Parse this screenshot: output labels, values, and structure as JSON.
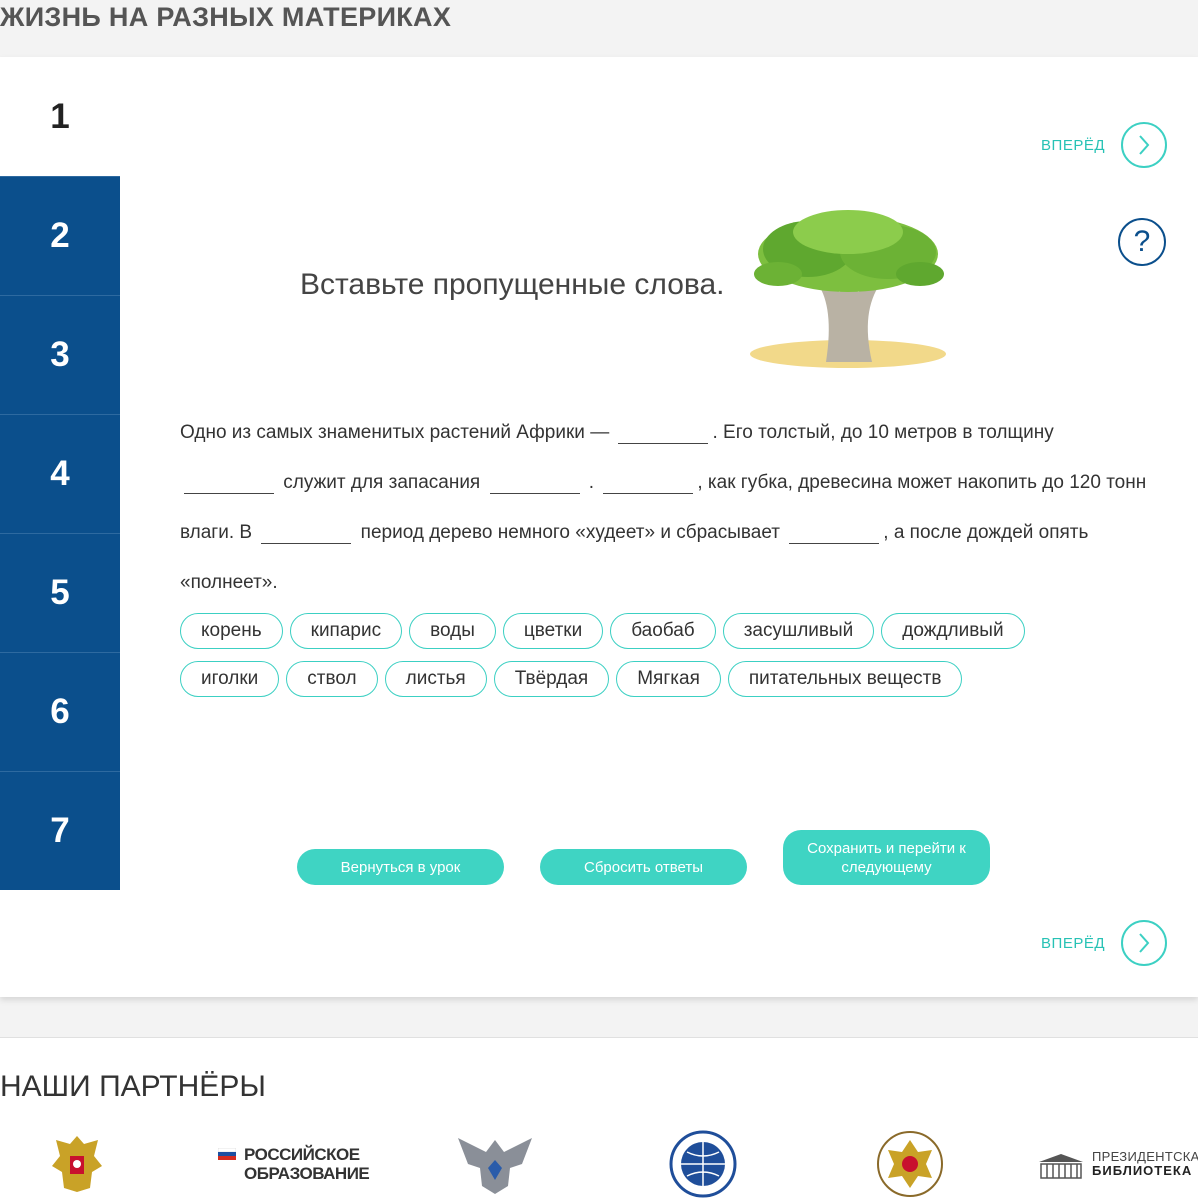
{
  "page_title": "ЖИЗНЬ НА РАЗНЫХ МАТЕРИКАХ",
  "steps": [
    "1",
    "2",
    "3",
    "4",
    "5",
    "6",
    "7"
  ],
  "nav": {
    "next_label": "ВПЕРЁД"
  },
  "task_title": "Вставьте пропущенные слова.",
  "text": {
    "s1": "Одно из самых знаменитых растений Африки —",
    "s2": ". Его толстый, до 10 метров в толщину",
    "s3": "служит для запасания",
    "s4": ".",
    "s5": ", как губка, древесина может накопить до 120 тонн",
    "s6": "влаги. В",
    "s7": "период дерево немного «худеет» и сбрасывает",
    "s8": ", а после дождей опять",
    "s9": "«полнеет»."
  },
  "chips": [
    "корень",
    "кипарис",
    "воды",
    "цветки",
    "баобаб",
    "засушливый",
    "дождливый",
    "иголки",
    "ствол",
    "листья",
    "Твёрдая",
    "Мягкая",
    "питательных веществ"
  ],
  "buttons": {
    "back": "Вернуться в урок",
    "reset": "Сбросить ответы",
    "save": "Сохранить и перейти к следующему"
  },
  "partners": {
    "title": "НАШИ ПАРТНЁРЫ",
    "ros_obr": [
      "РОССИЙСКОЕ",
      "ОБРАЗОВАНИЕ"
    ],
    "pres_lib": [
      "ПРЕЗИДЕНТСКАЯ",
      "БИБЛИОТЕКА"
    ]
  },
  "colors": {
    "accent": "#3fd4c3",
    "sidebar": "#0b4f8c"
  }
}
